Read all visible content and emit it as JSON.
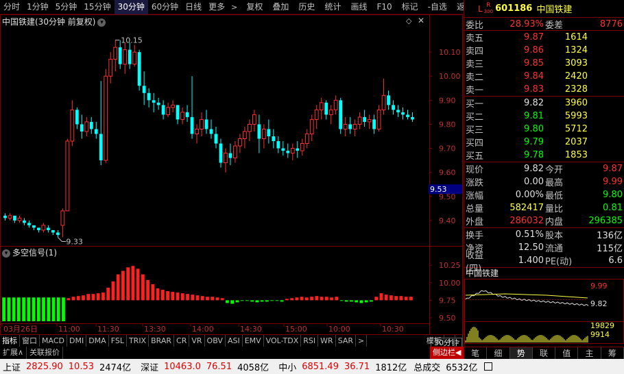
{
  "toolbar": {
    "items": [
      "分时",
      "1分钟",
      "5分钟",
      "15分钟",
      "30分钟",
      "60分钟",
      "日线",
      "更多"
    ],
    "more_arrow": ">",
    "actions": [
      "复权",
      "叠加",
      "历史",
      "统计",
      "画线",
      "F10",
      "标记",
      "-自选",
      "返回"
    ]
  },
  "chart": {
    "title": "中国铁建(30分钟 前复权)",
    "high_label": "10.15",
    "low_label": "9.33",
    "price_ticks": [
      "10.10",
      "10.00",
      "9.90",
      "9.80",
      "9.70",
      "9.60",
      "9.50",
      "9.40"
    ],
    "current_price_tag": "9.53",
    "indicator_title": "多空信号(1)",
    "indicator_ticks": [
      "10.25",
      "10.00",
      "9.75",
      "9.50"
    ],
    "time_labels": [
      "03月26日",
      "11:00",
      "11:30",
      "13:30",
      "14:00",
      "14:30",
      "15:00",
      "10:00",
      "10:30"
    ],
    "period": "30分钟"
  },
  "indicator_tabs": [
    "指标",
    "窗口",
    "MACD",
    "DMI",
    "DMA",
    "FSL",
    "TRIX",
    "BRAR",
    "CR",
    "VR",
    "OBV",
    "ASI",
    "EMV",
    "VOL-TDX",
    "RSI",
    "WR",
    "SAR",
    ">",
    "模板",
    "+",
    "-"
  ],
  "ext_tabs": [
    "扩展∧",
    "关联报价"
  ],
  "side_tag": "侧边栏◀",
  "panel": {
    "letter_l": "L",
    "letter_r": "R",
    "sub_300": "300",
    "code": "601186",
    "name": "中国铁建",
    "weibi_label": "委比",
    "weibi_value": "28.93%",
    "weicha_label": "委差",
    "weicha_value": "8776",
    "asks": [
      {
        "label": "卖五",
        "price": "9.87",
        "vol": "1614"
      },
      {
        "label": "卖四",
        "price": "9.86",
        "vol": "1324"
      },
      {
        "label": "卖三",
        "price": "9.85",
        "vol": "3093"
      },
      {
        "label": "卖二",
        "price": "9.84",
        "vol": "2420"
      },
      {
        "label": "卖一",
        "price": "9.83",
        "vol": "2328"
      }
    ],
    "bids": [
      {
        "label": "买一",
        "price": "9.82",
        "vol": "3960"
      },
      {
        "label": "买二",
        "price": "9.81",
        "vol": "5993"
      },
      {
        "label": "买三",
        "price": "9.80",
        "vol": "5712"
      },
      {
        "label": "买四",
        "price": "9.79",
        "vol": "2037"
      },
      {
        "label": "买五",
        "price": "9.78",
        "vol": "1853"
      }
    ],
    "stats": [
      {
        "l1": "现价",
        "v1": "9.82",
        "l2": "今开",
        "v2": "9.87"
      },
      {
        "l1": "涨跌",
        "v1": "0.00",
        "l2": "最高",
        "v2": "9.99"
      },
      {
        "l1": "涨幅",
        "v1": "0.00%",
        "l2": "最低",
        "v2": "9.80"
      },
      {
        "l1": "总量",
        "v1": "582417",
        "l2": "量比",
        "v2": "0.81"
      },
      {
        "l1": "外盘",
        "v1": "286032",
        "l2": "内盘",
        "v2": "296385"
      }
    ],
    "fundamentals": [
      {
        "l1": "换手",
        "v1": "0.51%",
        "l2": "股本",
        "v2": "136亿"
      },
      {
        "l1": "净资",
        "v1": "12.50",
        "l2": "流通",
        "v2": "115亿"
      },
      {
        "l1": "收益(四)",
        "v1": "1.400",
        "l2": "PE(动)",
        "v2": "6.6"
      }
    ],
    "mini_title": "中国铁建",
    "mini_high": "9.99",
    "mini_last": "9.82",
    "mini_vol_high": "19829",
    "mini_vol_low": "9914",
    "tabs": [
      "笔",
      "细",
      "势",
      "联",
      "值",
      "主",
      "筹"
    ]
  },
  "status": {
    "sh_label": "上证",
    "sh_index": "2825.90",
    "sh_change": "10.53",
    "sh_amount": "2474亿",
    "sz_label": "深证",
    "sz_index": "10463.0",
    "sz_change": "76.51",
    "sz_amount": "4058亿",
    "zx_label": "中小",
    "zx_index": "6851.49",
    "zx_change": "36.71",
    "zx_amount": "1812亿",
    "total_label": "总成交",
    "total_amount": "6532亿"
  },
  "colors": {
    "up": "#ff3030",
    "down": "#00ffff",
    "grid": "#800000",
    "signal_up": "#ff2020",
    "signal_down": "#00ff00"
  },
  "chart_data": {
    "type": "candlestick",
    "candles": [
      {
        "o": 9.42,
        "h": 9.43,
        "l": 9.4,
        "c": 9.41
      },
      {
        "o": 9.41,
        "h": 9.43,
        "l": 9.4,
        "c": 9.42
      },
      {
        "o": 9.42,
        "h": 9.42,
        "l": 9.39,
        "c": 9.4
      },
      {
        "o": 9.4,
        "h": 9.42,
        "l": 9.39,
        "c": 9.41
      },
      {
        "o": 9.4,
        "h": 9.41,
        "l": 9.38,
        "c": 9.39
      },
      {
        "o": 9.39,
        "h": 9.4,
        "l": 9.37,
        "c": 9.38
      },
      {
        "o": 9.38,
        "h": 9.38,
        "l": 9.36,
        "c": 9.37
      },
      {
        "o": 9.37,
        "h": 9.37,
        "l": 9.35,
        "c": 9.36
      },
      {
        "o": 9.36,
        "h": 9.39,
        "l": 9.35,
        "c": 9.38
      },
      {
        "o": 9.37,
        "h": 9.38,
        "l": 9.35,
        "c": 9.36
      },
      {
        "o": 9.36,
        "h": 9.36,
        "l": 9.34,
        "c": 9.35
      },
      {
        "o": 9.35,
        "h": 9.36,
        "l": 9.33,
        "c": 9.34
      },
      {
        "o": 9.38,
        "h": 9.45,
        "l": 9.33,
        "c": 9.44
      },
      {
        "o": 9.44,
        "h": 9.74,
        "l": 9.44,
        "c": 9.73
      },
      {
        "o": 9.73,
        "h": 9.9,
        "l": 9.71,
        "c": 9.86
      },
      {
        "o": 9.86,
        "h": 9.87,
        "l": 9.78,
        "c": 9.8
      },
      {
        "o": 9.8,
        "h": 9.84,
        "l": 9.74,
        "c": 9.77
      },
      {
        "o": 9.77,
        "h": 9.83,
        "l": 9.75,
        "c": 9.81
      },
      {
        "o": 9.81,
        "h": 9.83,
        "l": 9.76,
        "c": 9.78
      },
      {
        "o": 9.78,
        "h": 9.81,
        "l": 9.74,
        "c": 9.76
      },
      {
        "o": 9.76,
        "h": 9.98,
        "l": 9.63,
        "c": 9.65
      },
      {
        "o": 9.65,
        "h": 10.03,
        "l": 9.64,
        "c": 10.0
      },
      {
        "o": 10.0,
        "h": 10.1,
        "l": 9.97,
        "c": 10.07
      },
      {
        "o": 10.07,
        "h": 10.15,
        "l": 10.02,
        "c": 10.12
      },
      {
        "o": 10.12,
        "h": 10.15,
        "l": 10.03,
        "c": 10.05
      },
      {
        "o": 10.05,
        "h": 10.14,
        "l": 10.01,
        "c": 10.11
      },
      {
        "o": 10.11,
        "h": 10.14,
        "l": 10.03,
        "c": 10.05
      },
      {
        "o": 10.05,
        "h": 10.13,
        "l": 10.04,
        "c": 10.1
      },
      {
        "o": 10.1,
        "h": 10.11,
        "l": 9.94,
        "c": 9.96
      },
      {
        "o": 9.96,
        "h": 10.02,
        "l": 9.88,
        "c": 9.93
      },
      {
        "o": 9.93,
        "h": 9.95,
        "l": 9.87,
        "c": 9.9
      },
      {
        "o": 9.9,
        "h": 9.93,
        "l": 9.85,
        "c": 9.89
      },
      {
        "o": 9.89,
        "h": 9.91,
        "l": 9.86,
        "c": 9.88
      },
      {
        "o": 9.88,
        "h": 9.9,
        "l": 9.82,
        "c": 9.84
      },
      {
        "o": 9.84,
        "h": 9.89,
        "l": 9.83,
        "c": 9.87
      },
      {
        "o": 9.87,
        "h": 9.9,
        "l": 9.85,
        "c": 9.88
      },
      {
        "o": 9.88,
        "h": 9.88,
        "l": 9.8,
        "c": 9.82
      },
      {
        "o": 9.82,
        "h": 9.87,
        "l": 9.8,
        "c": 9.85
      },
      {
        "o": 9.85,
        "h": 9.88,
        "l": 9.81,
        "c": 9.83
      },
      {
        "o": 9.83,
        "h": 10.0,
        "l": 9.74,
        "c": 9.76
      },
      {
        "o": 9.76,
        "h": 9.8,
        "l": 9.72,
        "c": 9.78
      },
      {
        "o": 9.78,
        "h": 9.85,
        "l": 9.75,
        "c": 9.82
      },
      {
        "o": 9.82,
        "h": 9.86,
        "l": 9.76,
        "c": 9.78
      },
      {
        "o": 9.78,
        "h": 9.82,
        "l": 9.74,
        "c": 9.76
      },
      {
        "o": 9.76,
        "h": 9.79,
        "l": 9.7,
        "c": 9.72
      },
      {
        "o": 9.72,
        "h": 9.74,
        "l": 9.62,
        "c": 9.64
      },
      {
        "o": 9.64,
        "h": 9.7,
        "l": 9.6,
        "c": 9.68
      },
      {
        "o": 9.68,
        "h": 9.72,
        "l": 9.63,
        "c": 9.66
      },
      {
        "o": 9.66,
        "h": 9.73,
        "l": 9.64,
        "c": 9.71
      },
      {
        "o": 9.71,
        "h": 9.76,
        "l": 9.68,
        "c": 9.74
      },
      {
        "o": 9.74,
        "h": 9.79,
        "l": 9.7,
        "c": 9.77
      },
      {
        "o": 9.77,
        "h": 9.82,
        "l": 9.73,
        "c": 9.8
      },
      {
        "o": 9.8,
        "h": 9.86,
        "l": 9.77,
        "c": 9.84
      },
      {
        "o": 9.8,
        "h": 9.84,
        "l": 9.68,
        "c": 9.74
      },
      {
        "o": 9.74,
        "h": 9.8,
        "l": 9.7,
        "c": 9.78
      },
      {
        "o": 9.78,
        "h": 9.82,
        "l": 9.72,
        "c": 9.75
      },
      {
        "o": 9.75,
        "h": 9.78,
        "l": 9.7,
        "c": 9.73
      },
      {
        "o": 9.73,
        "h": 9.75,
        "l": 9.68,
        "c": 9.7
      },
      {
        "o": 9.7,
        "h": 9.73,
        "l": 9.67,
        "c": 9.69
      },
      {
        "o": 9.69,
        "h": 9.72,
        "l": 9.66,
        "c": 9.68
      },
      {
        "o": 9.68,
        "h": 9.72,
        "l": 9.65,
        "c": 9.7
      },
      {
        "o": 9.7,
        "h": 9.73,
        "l": 9.66,
        "c": 9.69
      },
      {
        "o": 9.69,
        "h": 9.74,
        "l": 9.67,
        "c": 9.72
      },
      {
        "o": 9.72,
        "h": 9.78,
        "l": 9.7,
        "c": 9.76
      },
      {
        "o": 9.76,
        "h": 9.84,
        "l": 9.73,
        "c": 9.82
      },
      {
        "o": 9.82,
        "h": 9.88,
        "l": 9.78,
        "c": 9.86
      },
      {
        "o": 9.86,
        "h": 9.91,
        "l": 9.82,
        "c": 9.89
      },
      {
        "o": 9.89,
        "h": 9.9,
        "l": 9.82,
        "c": 9.84
      },
      {
        "o": 9.84,
        "h": 9.88,
        "l": 9.8,
        "c": 9.86
      },
      {
        "o": 9.86,
        "h": 9.92,
        "l": 9.84,
        "c": 9.9
      },
      {
        "o": 9.9,
        "h": 9.91,
        "l": 9.76,
        "c": 9.78
      },
      {
        "o": 9.78,
        "h": 9.83,
        "l": 9.75,
        "c": 9.8
      },
      {
        "o": 9.8,
        "h": 9.83,
        "l": 9.76,
        "c": 9.78
      },
      {
        "o": 9.78,
        "h": 9.82,
        "l": 9.75,
        "c": 9.8
      },
      {
        "o": 9.8,
        "h": 9.85,
        "l": 9.78,
        "c": 9.83
      },
      {
        "o": 9.83,
        "h": 9.86,
        "l": 9.79,
        "c": 9.81
      },
      {
        "o": 9.81,
        "h": 9.84,
        "l": 9.78,
        "c": 9.82
      },
      {
        "o": 9.82,
        "h": 9.84,
        "l": 9.76,
        "c": 9.78
      },
      {
        "o": 9.78,
        "h": 9.88,
        "l": 9.77,
        "c": 9.86
      },
      {
        "o": 9.86,
        "h": 9.99,
        "l": 9.84,
        "c": 9.92
      },
      {
        "o": 9.92,
        "h": 9.94,
        "l": 9.86,
        "c": 9.88
      },
      {
        "o": 9.88,
        "h": 9.9,
        "l": 9.84,
        "c": 9.86
      },
      {
        "o": 9.86,
        "h": 9.88,
        "l": 9.83,
        "c": 9.85
      },
      {
        "o": 9.85,
        "h": 9.87,
        "l": 9.82,
        "c": 9.84
      },
      {
        "o": 9.84,
        "h": 9.86,
        "l": 9.82,
        "c": 9.83
      },
      {
        "o": 9.83,
        "h": 9.85,
        "l": 9.81,
        "c": 9.82
      }
    ],
    "signal": [
      -9.43,
      -9.43,
      -9.43,
      -9.43,
      -9.43,
      -9.43,
      -9.43,
      -9.43,
      -9.43,
      -9.43,
      -9.43,
      -9.43,
      -9.43,
      9.78,
      9.8,
      9.81,
      9.82,
      9.84,
      9.84,
      9.85,
      9.86,
      9.93,
      10.02,
      10.12,
      10.17,
      10.22,
      10.24,
      10.2,
      10.12,
      10.04,
      9.98,
      9.92,
      9.9,
      9.88,
      9.87,
      9.86,
      9.85,
      9.84,
      9.83,
      9.82,
      9.81,
      9.8,
      9.8,
      9.79,
      9.78,
      -9.71,
      -9.7,
      -9.72,
      -9.74,
      -9.74,
      -9.73,
      -9.72,
      -9.73,
      -9.73,
      -9.75,
      -9.74,
      -9.73,
      9.77,
      9.78,
      9.79,
      9.8,
      9.79,
      9.8,
      9.81,
      9.8,
      9.8,
      9.79,
      9.8,
      -9.76,
      -9.77,
      -9.77,
      -9.78,
      -9.79,
      -9.78,
      -9.77,
      9.8,
      9.85,
      9.83,
      9.82,
      9.81,
      9.81,
      9.8,
      9.8
    ],
    "price_range": [
      9.3,
      10.2
    ],
    "indicator_range": [
      9.45,
      10.35
    ]
  }
}
